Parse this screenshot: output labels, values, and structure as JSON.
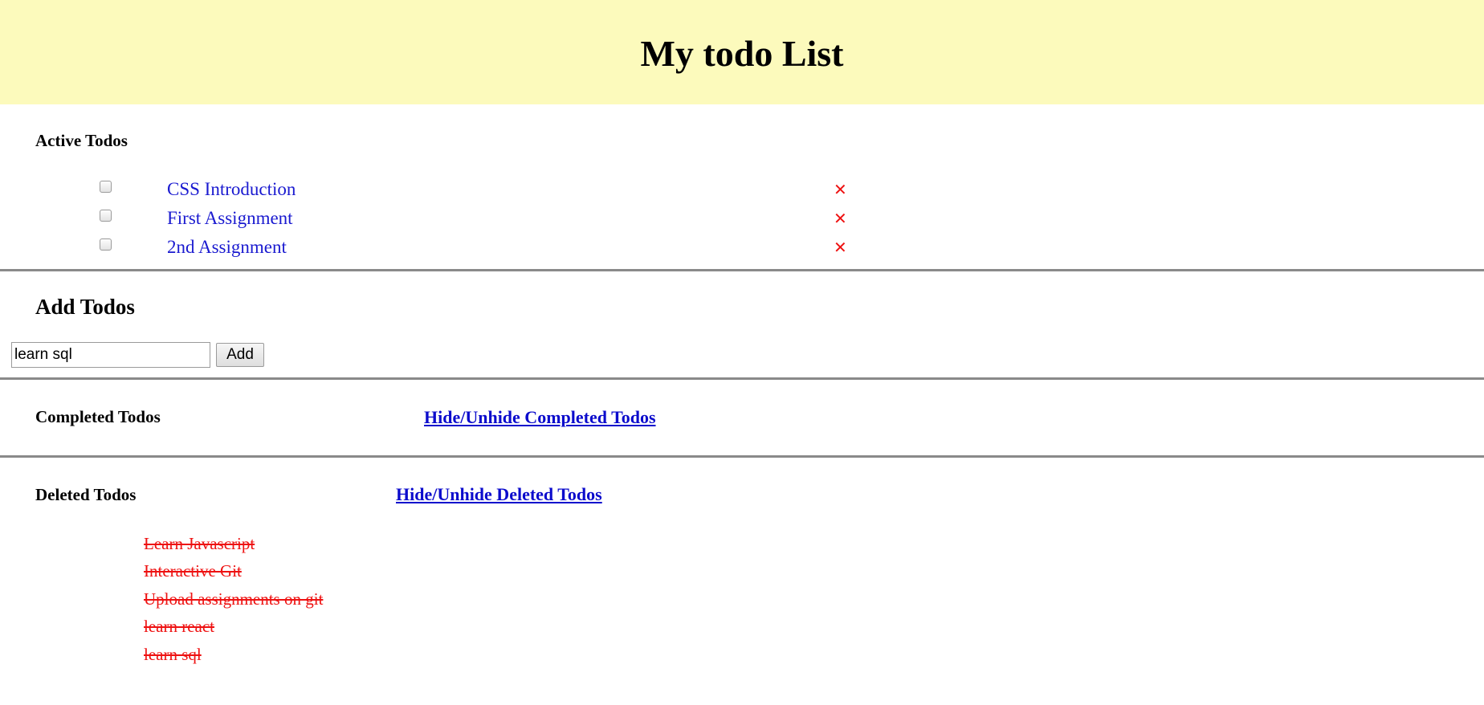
{
  "header": {
    "title": "My todo List",
    "background": "#fcfabc"
  },
  "active": {
    "title": "Active Todos",
    "items": [
      {
        "label": "CSS Introduction",
        "checked": false,
        "delete_icon": "close-x-icon"
      },
      {
        "label": "First Assignment",
        "checked": false,
        "delete_icon": "close-x-icon"
      },
      {
        "label": "2nd Assignment",
        "checked": false,
        "delete_icon": "close-x-icon"
      }
    ]
  },
  "add": {
    "title": "Add Todos",
    "input_value": "learn sql",
    "button_label": "Add"
  },
  "completed": {
    "title": "Completed Todos",
    "toggle_label": "Hide/Unhide Completed Todos"
  },
  "deleted": {
    "title": "Deleted Todos",
    "toggle_label": "Hide/Unhide Deleted Todos",
    "items": [
      "Learn Javascript",
      "Interactive Git",
      "Upload assignments on git",
      "learn react",
      "learn sql"
    ]
  },
  "colors": {
    "link": "#0b0bcc",
    "todo_text": "#1a1ad0",
    "delete_icon": "#ee1111",
    "deleted_text": "#ee1111",
    "divider": "#8a8a8a"
  }
}
